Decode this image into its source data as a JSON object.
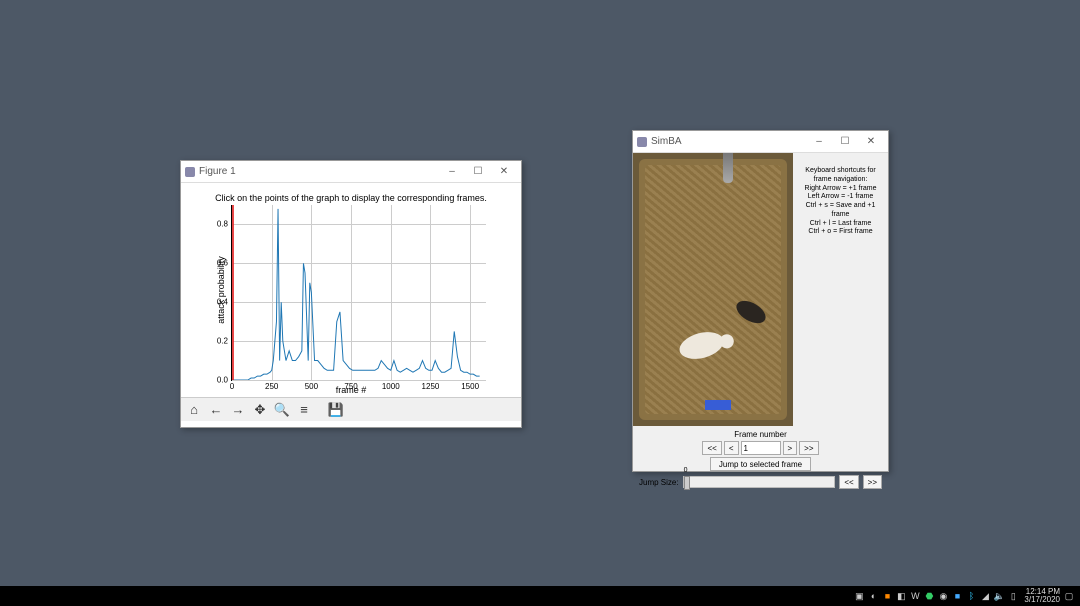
{
  "figure_window": {
    "title": "Figure 1",
    "minimize": "–",
    "maximize": "☐",
    "close": "✕",
    "title_text": "Click on the points of the graph to display the corresponding frames.",
    "xlabel": "frame #",
    "ylabel": "attack probability",
    "toolbar": {
      "home": "⌂",
      "back": "←",
      "forward": "→",
      "pan": "✥",
      "zoom": "🔍",
      "subplots": "≡",
      "save": "💾"
    }
  },
  "simba_window": {
    "title": "SimBA",
    "minimize": "–",
    "maximize": "☐",
    "close": "✕",
    "help_header": "Keyboard shortcuts for frame navigation:",
    "help_lines": [
      "Right Arrow = +1 frame",
      "Left Arrow = -1 frame",
      "Ctrl + s = Save and +1 frame",
      "Ctrl + l = Last frame",
      "Ctrl + o = First frame"
    ],
    "frame_label": "Frame number",
    "first": "<<",
    "prev": "<",
    "frame_value": "1",
    "next": ">",
    "last": ">>",
    "jump_to_frame": "Jump to selected frame",
    "jump_size_label": "Jump Size:",
    "jump_size_value": "0",
    "jump_back": "<<",
    "jump_fwd": ">>",
    "video_label": ""
  },
  "taskbar": {
    "time": "12:14 PM",
    "date": "3/17/2020"
  },
  "chart_data": {
    "type": "line",
    "title": "Click on the points of the graph to display the corresponding frames.",
    "xlabel": "frame #",
    "ylabel": "attack probability",
    "xlim": [
      0,
      1600
    ],
    "ylim": [
      0.0,
      0.9
    ],
    "xticks": [
      0,
      250,
      500,
      750,
      1000,
      1250,
      1500
    ],
    "yticks": [
      0.0,
      0.2,
      0.4,
      0.6,
      0.8
    ],
    "marker_x": 1,
    "x": [
      0,
      20,
      40,
      60,
      80,
      100,
      120,
      140,
      160,
      180,
      200,
      220,
      240,
      250,
      260,
      280,
      290,
      300,
      310,
      320,
      340,
      360,
      380,
      400,
      420,
      440,
      450,
      460,
      480,
      490,
      500,
      520,
      540,
      560,
      580,
      600,
      620,
      640,
      660,
      680,
      700,
      720,
      740,
      760,
      780,
      800,
      820,
      840,
      860,
      880,
      900,
      920,
      940,
      960,
      980,
      1000,
      1020,
      1040,
      1060,
      1080,
      1100,
      1120,
      1140,
      1160,
      1180,
      1200,
      1220,
      1240,
      1260,
      1280,
      1300,
      1320,
      1340,
      1360,
      1380,
      1400,
      1420,
      1440,
      1460,
      1480,
      1500,
      1520,
      1540,
      1560
    ],
    "values": [
      0.0,
      0.0,
      0.0,
      0.0,
      0.0,
      0.0,
      0.01,
      0.01,
      0.02,
      0.02,
      0.03,
      0.03,
      0.04,
      0.05,
      0.1,
      0.3,
      0.88,
      0.1,
      0.4,
      0.2,
      0.1,
      0.15,
      0.1,
      0.1,
      0.12,
      0.15,
      0.6,
      0.55,
      0.1,
      0.5,
      0.45,
      0.1,
      0.1,
      0.08,
      0.06,
      0.05,
      0.05,
      0.05,
      0.3,
      0.35,
      0.1,
      0.08,
      0.06,
      0.05,
      0.05,
      0.05,
      0.05,
      0.05,
      0.05,
      0.05,
      0.05,
      0.06,
      0.1,
      0.08,
      0.06,
      0.05,
      0.1,
      0.05,
      0.04,
      0.05,
      0.06,
      0.05,
      0.04,
      0.05,
      0.06,
      0.1,
      0.06,
      0.05,
      0.05,
      0.1,
      0.06,
      0.04,
      0.04,
      0.05,
      0.06,
      0.25,
      0.12,
      0.05,
      0.04,
      0.04,
      0.03,
      0.03,
      0.02,
      0.02
    ]
  }
}
